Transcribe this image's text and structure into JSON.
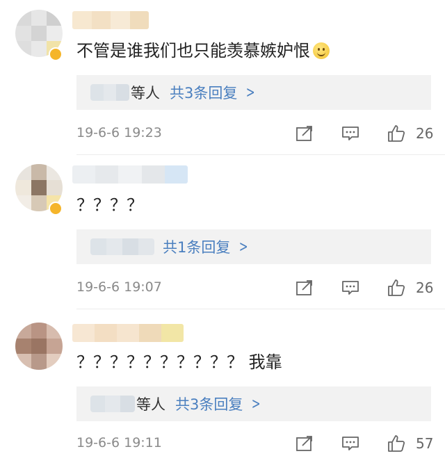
{
  "comments": [
    {
      "text": "不管是谁我们也只能羡慕嫉妒恨",
      "has_emoji": true,
      "emoji_icon": "smile-emoji-icon",
      "reply_who": "等人",
      "reply_count": "共3条回复",
      "time": "19-6-6 19:23",
      "likes": "26"
    },
    {
      "text": "？？？？",
      "has_emoji": false,
      "reply_who": "",
      "reply_count": "共1条回复",
      "time": "19-6-6 19:07",
      "likes": "26"
    },
    {
      "text": "？？？？？？？？？？ 我靠",
      "has_emoji": false,
      "reply_who": "等人",
      "reply_count": "共3条回复",
      "time": "19-6-6 19:11",
      "likes": "57"
    }
  ],
  "icons": {
    "share": "share-icon",
    "comment": "comment-icon",
    "like": "thumbs-up-icon",
    "chevron": "chevron-right-icon"
  },
  "colors": {
    "link": "#4a7fbf",
    "time": "#8a8a8a",
    "reply_bg": "#f2f2f2"
  }
}
